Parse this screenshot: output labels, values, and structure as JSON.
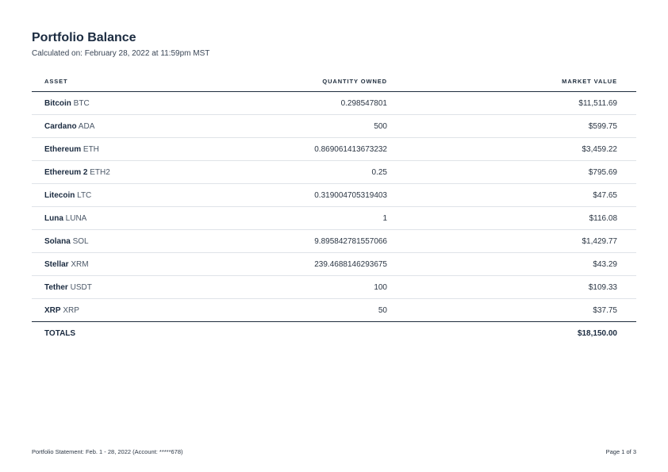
{
  "document": {
    "title": "Portfolio Balance",
    "subtitle": "Calculated on: February 28, 2022 at 11:59pm MST"
  },
  "table": {
    "headers": {
      "asset": "ASSET",
      "quantity": "QUANTITY OWNED",
      "value": "MARKET VALUE"
    },
    "rows": [
      {
        "name": "Bitcoin",
        "symbol": "BTC",
        "quantity": "0.298547801",
        "value": "$11,511.69"
      },
      {
        "name": "Cardano",
        "symbol": "ADA",
        "quantity": "500",
        "value": "$599.75"
      },
      {
        "name": "Ethereum",
        "symbol": "ETH",
        "quantity": "0.869061413673232",
        "value": "$3,459.22"
      },
      {
        "name": "Ethereum 2",
        "symbol": "ETH2",
        "quantity": "0.25",
        "value": "$795.69"
      },
      {
        "name": "Litecoin",
        "symbol": "LTC",
        "quantity": "0.319004705319403",
        "value": "$47.65"
      },
      {
        "name": "Luna",
        "symbol": "LUNA",
        "quantity": "1",
        "value": "$116.08"
      },
      {
        "name": "Solana",
        "symbol": "SOL",
        "quantity": "9.895842781557066",
        "value": "$1,429.77"
      },
      {
        "name": "Stellar",
        "symbol": "XRM",
        "quantity": "239.4688146293675",
        "value": "$43.29"
      },
      {
        "name": "Tether",
        "symbol": "USDT",
        "quantity": "100",
        "value": "$109.33"
      },
      {
        "name": "XRP",
        "symbol": "XRP",
        "quantity": "50",
        "value": "$37.75"
      }
    ],
    "totals": {
      "label": "TOTALS",
      "value": "$18,150.00"
    }
  },
  "footer": {
    "statement": "Portfolio Statement: Feb. 1 - 28, 2022 (Account: *****678)",
    "page": "Page 1 of 3"
  }
}
